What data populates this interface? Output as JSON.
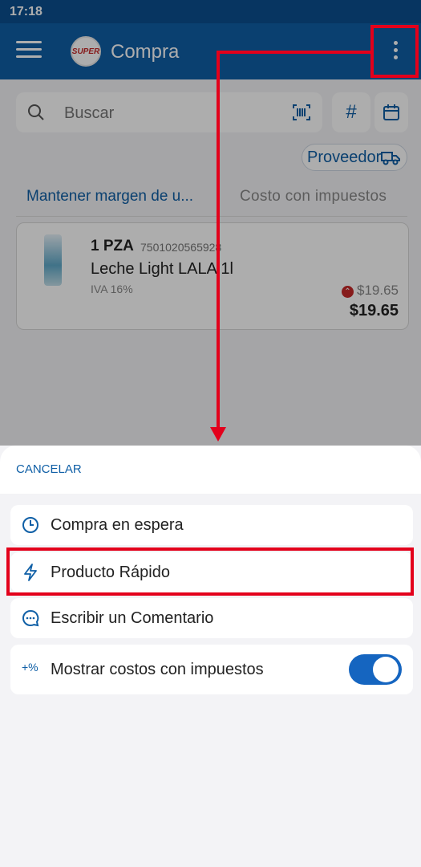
{
  "status_bar": {
    "time": "17:18"
  },
  "app_bar": {
    "title": "Compra",
    "logo_text": "SUPER"
  },
  "search": {
    "placeholder": "Buscar"
  },
  "filters": {
    "hash_label": "#",
    "provider_label": "Proveedor"
  },
  "tabs": {
    "margin_label": "Mantener margen de u...",
    "cost_label": "Costo con impuestos"
  },
  "product": {
    "quantity": "1 PZA",
    "barcode": "7501020565928",
    "name": "Leche Light LALA 1l",
    "tax": "IVA 16%",
    "old_price": "$19.65",
    "price": "$19.65"
  },
  "sheet": {
    "cancel_label": "CANCELAR",
    "items": [
      {
        "label": "Compra en espera",
        "icon": "clock-icon"
      },
      {
        "label": "Producto Rápido",
        "icon": "lightning-icon"
      },
      {
        "label": "Escribir un Comentario",
        "icon": "comment-icon"
      },
      {
        "label": "Mostrar costos con impuestos",
        "icon": "plus-percent-icon",
        "toggle_on": true
      }
    ]
  },
  "colors": {
    "primary": "#0f5fa6",
    "status_bar": "#0b4f8f",
    "highlight": "#e3001b",
    "price_down": "#c62828"
  }
}
